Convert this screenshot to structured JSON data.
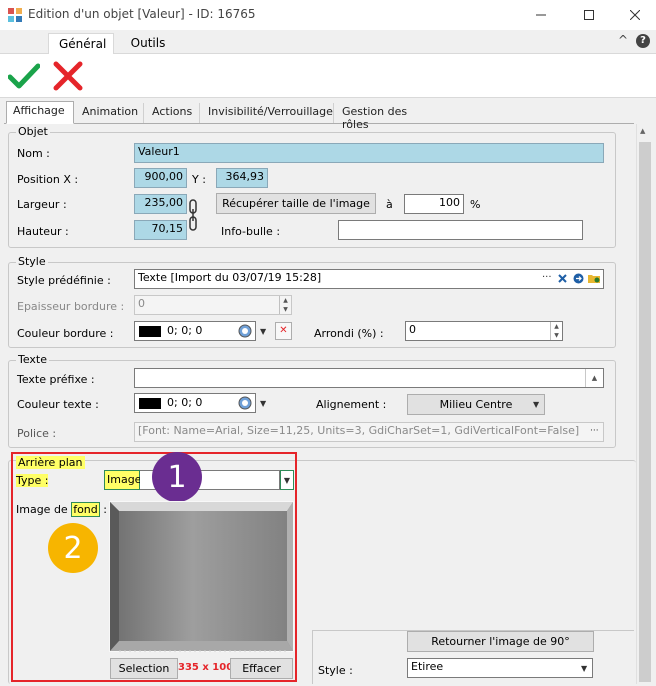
{
  "window": {
    "title": "Edition d'un objet [Valeur] - ID: 16765",
    "minimize_icon": "minimize-icon",
    "maximize_icon": "maximize-icon",
    "close_icon": "close-icon"
  },
  "ribbon": {
    "tabs": [
      {
        "label": "Général"
      },
      {
        "label": "Outils"
      }
    ],
    "collapse_glyph": "^",
    "help_glyph": "?"
  },
  "tabs": [
    {
      "label": "Affichage"
    },
    {
      "label": "Animation"
    },
    {
      "label": "Actions"
    },
    {
      "label": "Invisibilité/Verrouillage"
    },
    {
      "label": "Gestion des rôles"
    }
  ],
  "objet": {
    "title": "Objet",
    "nom_label": "Nom :",
    "nom_value": "Valeur1",
    "posx_label": "Position X :",
    "posx_value": "900,00",
    "y_label": "Y :",
    "y_value": "364,93",
    "largeur_label": "Largeur :",
    "largeur_value": "235,00",
    "hauteur_label": "Hauteur :",
    "hauteur_value": "70,15",
    "recup_button": "Récupérer taille de l'image",
    "a_label": "à",
    "percent_value": "100",
    "percent_sign": "%",
    "infobulle_label": "Info-bulle :",
    "infobulle_value": ""
  },
  "style": {
    "title": "Style",
    "predef_label": "Style prédéfinie :",
    "predef_value": "Texte [Import du 03/07/19 15:28]",
    "epaisseur_label": "Epaisseur bordure :",
    "epaisseur_value": "0",
    "couleur_label": "Couleur bordure :",
    "couleur_value": "0; 0; 0",
    "arrondi_label": "Arrondi (%) :",
    "arrondi_value": "0"
  },
  "texte": {
    "title": "Texte",
    "prefixe_label": "Texte préfixe :",
    "prefixe_value": "",
    "couleur_label": "Couleur texte :",
    "couleur_value": "0; 0; 0",
    "alignement_label": "Alignement :",
    "alignement_value": "Milieu Centre",
    "police_label": "Police :",
    "police_value": "[Font: Name=Arial, Size=11,25, Units=3, GdiCharSet=1, GdiVerticalFont=False]"
  },
  "arriere": {
    "title": "Arrière plan",
    "type_label": "Type :",
    "type_value": "Image",
    "image_label_a": "Image de ",
    "image_label_b": "fond",
    "image_label_c": " :",
    "selection_button": "Selection",
    "size_text": "335 x 100",
    "effacer_button": "Effacer",
    "retourner_button": "Retourner l'image de 90°",
    "style_label": "Style :",
    "style_value": "Etiree"
  },
  "badges": {
    "one": "1",
    "two": "2"
  },
  "colors": {
    "accent_red": "#e5252a",
    "badge_purple": "#6a2d91",
    "badge_yellow": "#f7b500",
    "highlight": "#ffff66",
    "field_blue": "#add8e6",
    "check_green": "#1aa34a"
  }
}
